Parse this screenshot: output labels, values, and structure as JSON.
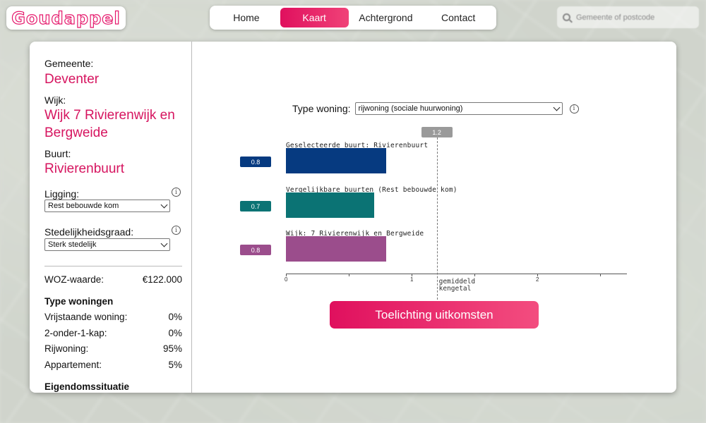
{
  "brand": {
    "logo_text": "Goudappel",
    "accent": "#e5176b"
  },
  "nav": {
    "items": [
      {
        "label": "Home",
        "active": false
      },
      {
        "label": "Kaart",
        "active": true
      },
      {
        "label": "Achtergrond",
        "active": false
      },
      {
        "label": "Contact",
        "active": false
      }
    ]
  },
  "search": {
    "placeholder": "Gemeente of postcode",
    "icon": "search-icon"
  },
  "sidebar": {
    "gemeente_label": "Gemeente:",
    "gemeente_value": "Deventer",
    "wijk_label": "Wijk:",
    "wijk_value_line1": "Wijk 7 Rivierenwijk en",
    "wijk_value_line2": "Bergweide",
    "buurt_label": "Buurt:",
    "buurt_value": "Rivierenbuurt",
    "ligging_label": "Ligging:",
    "ligging_value": "Rest bebouwde kom",
    "sted_label": "Stedelijkheidsgraad:",
    "sted_value": "Sterk stedelijk",
    "info_glyph": "i",
    "woz_label": "WOZ-waarde:",
    "woz_value": "€122.000",
    "type_heading": "Type woningen",
    "types": [
      {
        "label": "Vrijstaande woning:",
        "value": "0%"
      },
      {
        "label": "2-onder-1-kap:",
        "value": "0%"
      },
      {
        "label": "Rijwoning:",
        "value": "95%"
      },
      {
        "label": "Appartement:",
        "value": "5%"
      }
    ],
    "eigendom_heading": "Eigendomssituatie"
  },
  "main": {
    "type_woning_label": "Type woning:",
    "type_woning_value": "rijwoning (sociale huurwoning)",
    "info_glyph": "i",
    "cta_label": "Toelichting uitkomsten"
  },
  "chart_data": {
    "type": "bar",
    "orientation": "horizontal",
    "categories": [
      "Geselecteerde buurt: Rivierenbuurt",
      "Vergelijkbare buurten (Rest bebouwde kom)",
      "Wijk: 7 Rivierenwijk en Bergweide"
    ],
    "values": [
      0.8,
      0.7,
      0.8
    ],
    "value_labels": [
      "0.8",
      "0.7",
      "0.8"
    ],
    "colors": [
      "#063a80",
      "#0b7374",
      "#9b4d8c"
    ],
    "xlim": [
      0,
      2.7
    ],
    "x_ticks": [
      0,
      1,
      2
    ],
    "x_tick_labels": [
      "0",
      "1",
      "2"
    ],
    "reference": {
      "value": 1.2,
      "badge": "1.2",
      "label_line1": "gemiddeld",
      "label_line2": "kengetal"
    }
  }
}
